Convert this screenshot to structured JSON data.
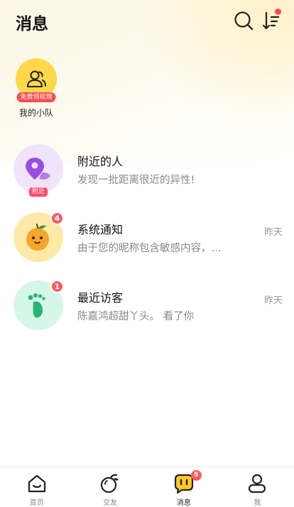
{
  "header": {
    "title": "消息",
    "search_icon": "search-icon",
    "sort_icon": "sort-icon"
  },
  "team": {
    "badge": "免费领玫瑰",
    "label": "我的小队",
    "icon": "group-icon",
    "color": "#ffd84a"
  },
  "conversations": [
    {
      "title": "附近的人",
      "subtitle": "发现一批距离很近的异性!",
      "tag": "附近",
      "time": "",
      "icon": "location-pin-icon",
      "color": "#f0e4fb"
    },
    {
      "title": "系统通知",
      "subtitle": "由于您的昵称包含敏感内容，...",
      "time": "昨天",
      "badge": "4",
      "icon": "orange-mascot-icon",
      "color": "#ffe9a6"
    },
    {
      "title": "最近访客",
      "subtitle": "陈嘉鸿超甜丫头。 看了你",
      "time": "昨天",
      "badge": "1",
      "icon": "footprint-icon",
      "color": "#d6f6e8"
    }
  ],
  "tabbar": {
    "tabs": [
      {
        "label": "首页",
        "icon": "home-icon"
      },
      {
        "label": "交友",
        "icon": "fruit-icon"
      },
      {
        "label": "消息",
        "icon": "message-icon",
        "badge": "5",
        "active": true
      },
      {
        "label": "我",
        "icon": "profile-icon"
      }
    ]
  },
  "colors": {
    "accent_yellow": "#ffd84a",
    "badge_red": "#ff5a5f"
  }
}
